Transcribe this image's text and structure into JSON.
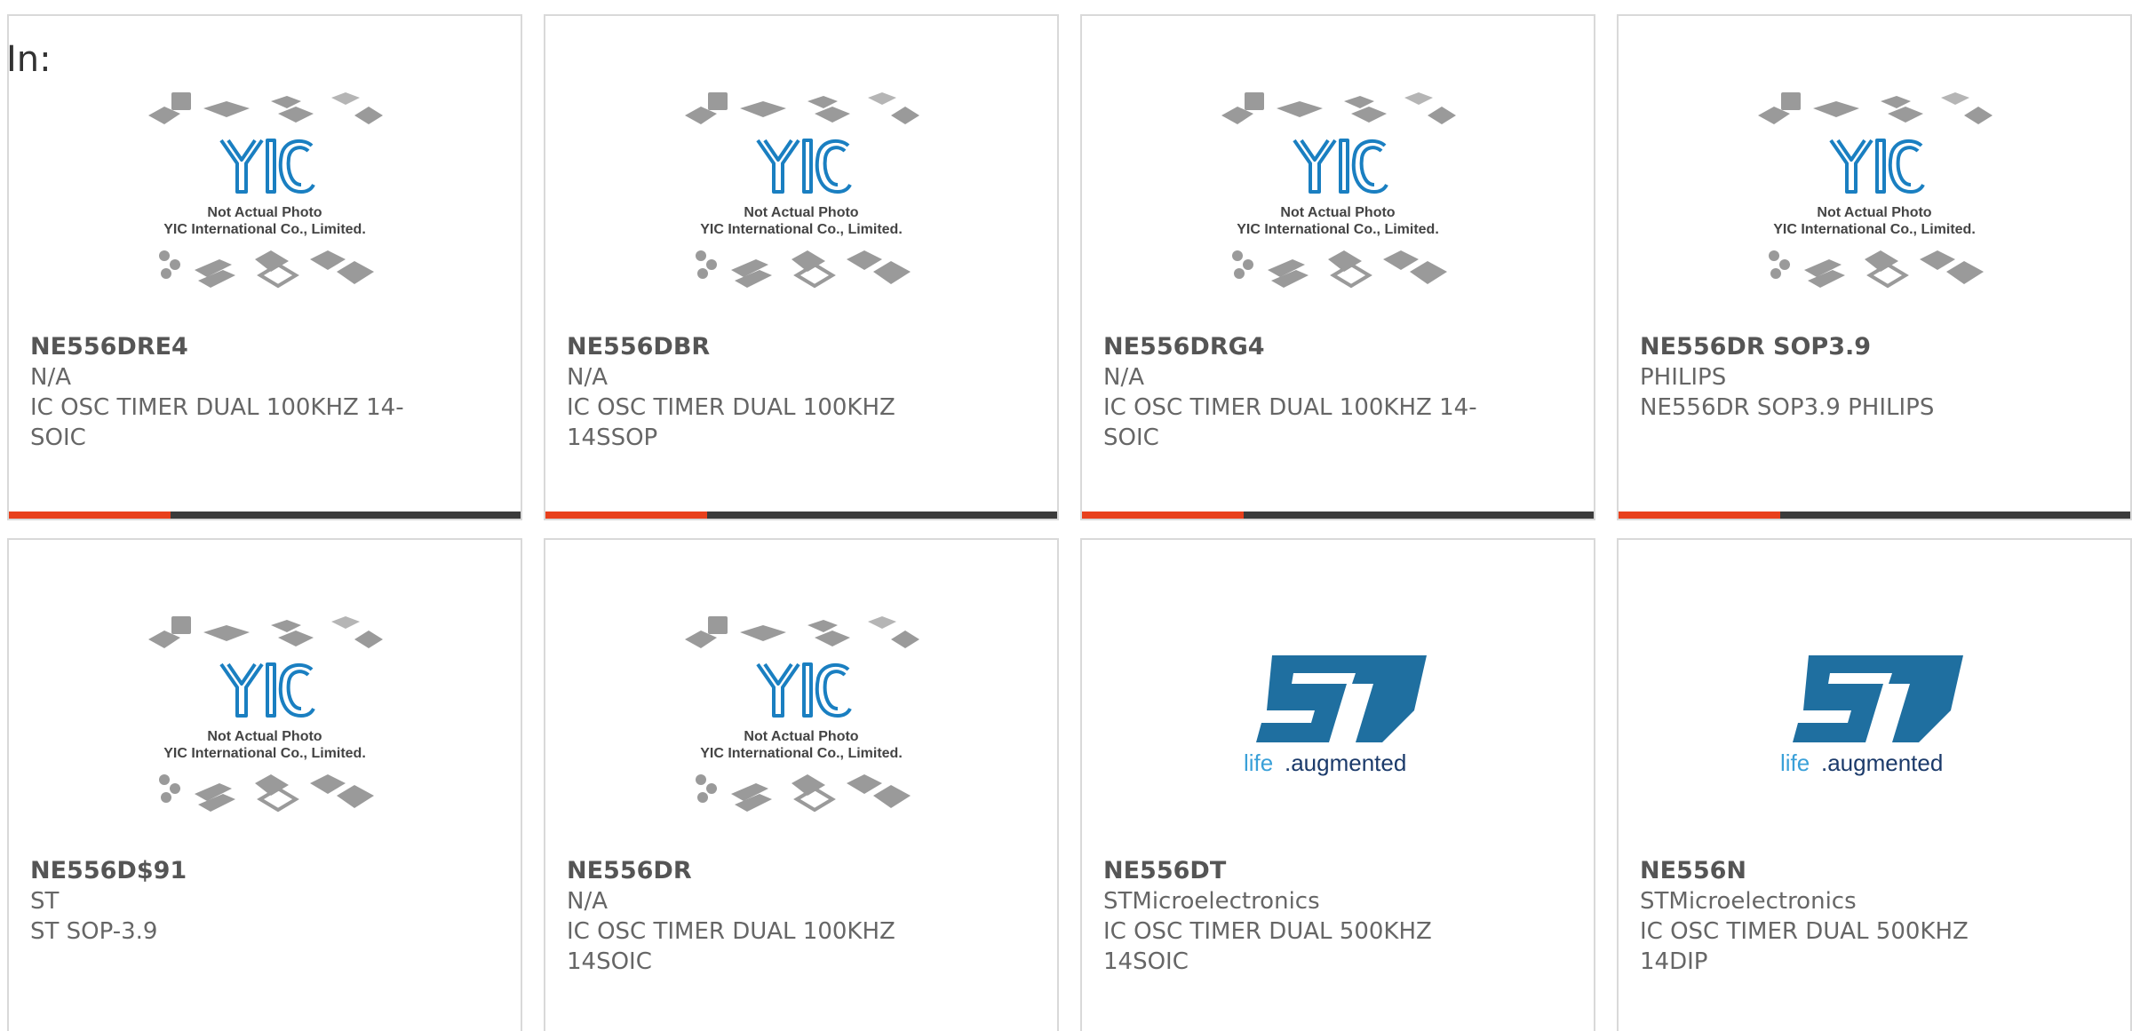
{
  "header": {
    "label": "In:"
  },
  "placeholder_image": {
    "line1": "Not Actual Photo",
    "line2": "YIC International Co., Limited."
  },
  "st_logo": {
    "text_life": "life",
    "text_aug": ".augmented"
  },
  "colors": {
    "accent": "#e8401c",
    "bar": "#3b3b3b",
    "yic_blue": "#1a7fc1",
    "st_blue": "#1f6fa0"
  },
  "products": [
    {
      "part": "NE556DRE4",
      "manufacturer": "N/A",
      "desc1": "IC OSC TIMER DUAL 100KHZ 14-",
      "desc2": "SOIC",
      "image": "yic-placeholder"
    },
    {
      "part": "NE556DBR",
      "manufacturer": "N/A",
      "desc1": "IC OSC TIMER DUAL 100KHZ",
      "desc2": "14SSOP",
      "image": "yic-placeholder"
    },
    {
      "part": "NE556DRG4",
      "manufacturer": "N/A",
      "desc1": "IC OSC TIMER DUAL 100KHZ 14-",
      "desc2": "SOIC",
      "image": "yic-placeholder"
    },
    {
      "part": "NE556DR SOP3.9",
      "manufacturer": "PHILIPS",
      "desc1": "NE556DR SOP3.9 PHILIPS",
      "desc2": "",
      "image": "yic-placeholder"
    },
    {
      "part": "NE556D$91",
      "manufacturer": "ST",
      "desc1": "ST SOP-3.9",
      "desc2": "",
      "image": "yic-placeholder"
    },
    {
      "part": "NE556DR",
      "manufacturer": "N/A",
      "desc1": "IC OSC TIMER DUAL 100KHZ",
      "desc2": "14SOIC",
      "image": "yic-placeholder"
    },
    {
      "part": "NE556DT",
      "manufacturer": "STMicroelectronics",
      "desc1": "IC OSC TIMER DUAL 500KHZ",
      "desc2": "14SOIC",
      "image": "st-logo"
    },
    {
      "part": "NE556N",
      "manufacturer": "STMicroelectronics",
      "desc1": "IC OSC TIMER DUAL 500KHZ",
      "desc2": "14DIP",
      "image": "st-logo"
    }
  ]
}
